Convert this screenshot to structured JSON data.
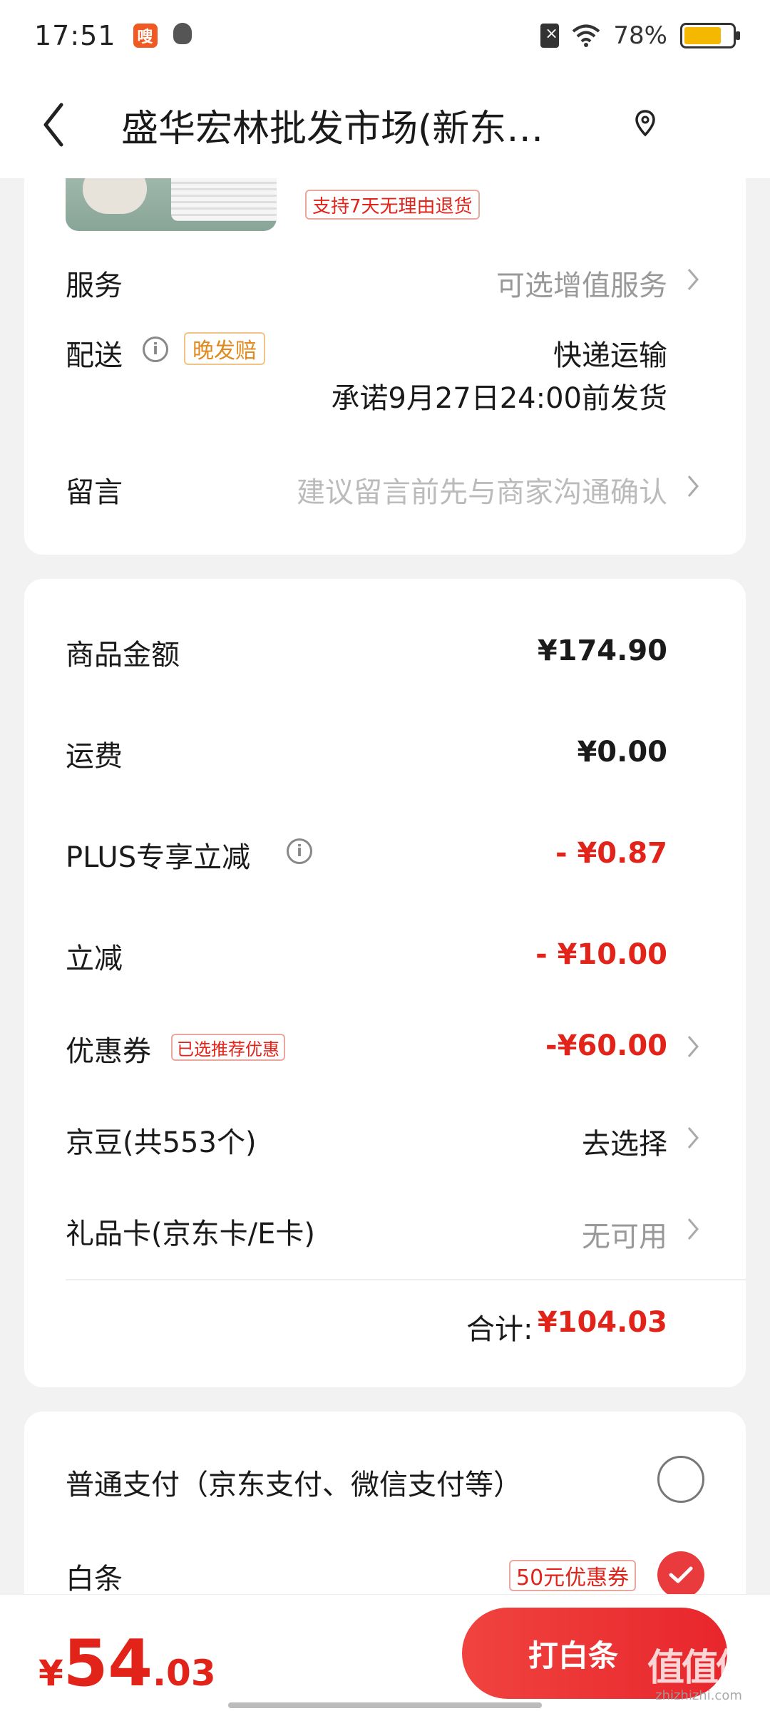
{
  "status_bar": {
    "time": "17:51",
    "app_icon_glyph": "嗖",
    "battery": "78%",
    "battery_level": 0.78,
    "icons": [
      "notification-app-icon",
      "qq-icon",
      "sim-icon",
      "wifi-icon",
      "battery-icon"
    ]
  },
  "header": {
    "title": "盛华宏林批发市场(新东…",
    "icons": [
      "back-icon",
      "location-icon"
    ]
  },
  "product": {
    "return_tag": "支持7天无理由退货"
  },
  "order_options": {
    "service_label": "服务",
    "service_value": "可选增值服务",
    "delivery_label": "配送",
    "delivery_tag": "晚发赔",
    "delivery_method": "快递运输",
    "delivery_promise": "承诺9月27日24:00前发货",
    "message_label": "留言",
    "message_placeholder": "建议留言前先与商家沟通确认"
  },
  "pricing": {
    "goods_label": "商品金额",
    "goods_value": "¥174.90",
    "freight_label": "运费",
    "freight_value": "¥0.00",
    "plus_label": "PLUS专享立减",
    "plus_value": "- ¥0.87",
    "discount_label": "立减",
    "discount_value": "- ¥10.00",
    "coupon_label": "优惠券",
    "coupon_tag": "已选推荐优惠",
    "coupon_value": "-¥60.00",
    "jingdou_label": "京豆(共553个)",
    "jingdou_value": "去选择",
    "giftcard_label": "礼品卡(京东卡/E卡)",
    "giftcard_value": "无可用",
    "total_label": "合计:",
    "total_value": "¥104.03"
  },
  "payment": {
    "normal_label": "普通支付（京东支付、微信支付等）",
    "baitiao_label": "白条",
    "baitiao_coupon": "50元优惠券",
    "normal_selected": false,
    "baitiao_selected": true
  },
  "bottom_bar": {
    "currency": "¥",
    "amount_int": "54",
    "amount_dec": ".03",
    "pay_button": "打白条",
    "watermark_logo": "值值值",
    "watermark_text": "zhizhizhi.com"
  },
  "colors": {
    "accent_red": "#e2231a",
    "button_red": "#e93b3d",
    "battery_yellow": "#f5b800",
    "tag_orange": "#e08a1e"
  }
}
